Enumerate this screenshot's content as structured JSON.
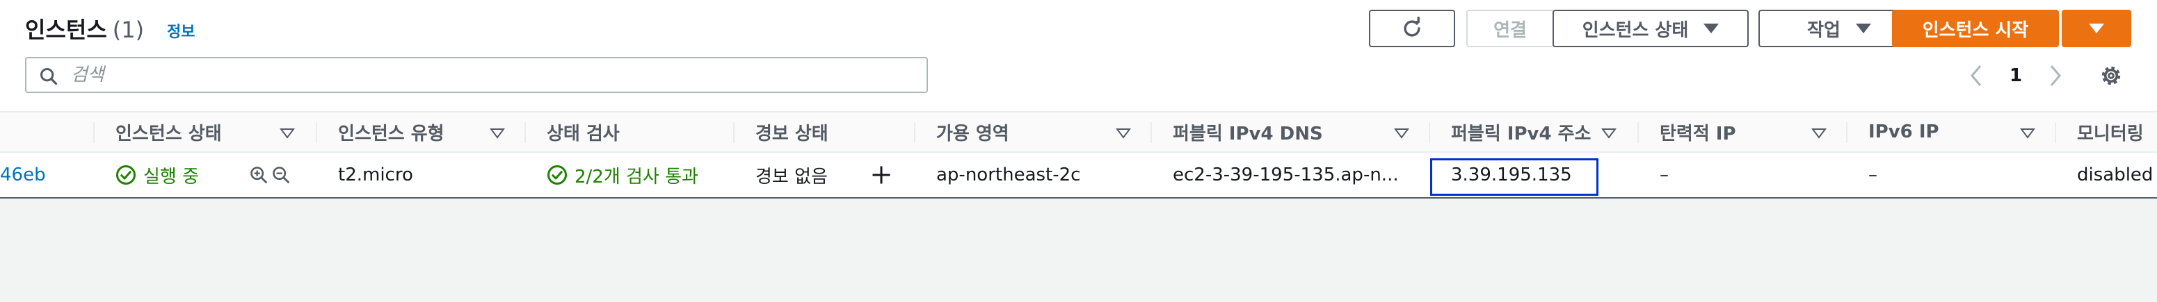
{
  "header": {
    "title": "인스턴스",
    "count": "(1)",
    "info_link": "정보"
  },
  "toolbar": {
    "connect_label": "연결",
    "instance_state_label": "인스턴스 상태",
    "actions_label": "작업",
    "launch_label": "인스턴스 시작"
  },
  "search": {
    "placeholder": "검색",
    "value": ""
  },
  "pagination": {
    "current_page": "1"
  },
  "table": {
    "columns": [
      "인스턴스 상태",
      "인스턴스 유형",
      "상태 검사",
      "경보 상태",
      "가용 영역",
      "퍼블릭 IPv4 DNS",
      "퍼블릭 IPv4 주소",
      "탄력적 IP",
      "IPv6 IP",
      "모니터링"
    ],
    "rows": [
      {
        "instance_id_partial": "46eb",
        "instance_state": "실행 중",
        "instance_type": "t2.micro",
        "status_check": "2/2개 검사 통과",
        "alarm_status": "경보 없음",
        "availability_zone": "ap-northeast-2c",
        "public_dns": "ec2-3-39-195-135.ap-n...",
        "public_ipv4": "3.39.195.135",
        "elastic_ip": "–",
        "ipv6_ip": "–",
        "monitoring": "disabled"
      }
    ]
  },
  "colors": {
    "primary_orange": "#ec7211",
    "link_blue": "#0073bb",
    "success_green": "#1d8102",
    "focus_blue": "#0033cc"
  }
}
